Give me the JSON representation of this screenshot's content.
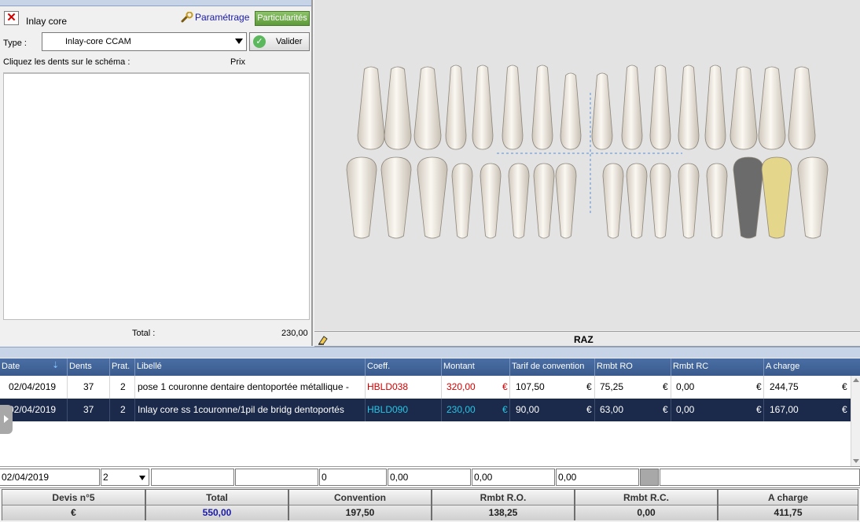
{
  "panel": {
    "title": "Inlay core",
    "close_icon": "✕",
    "param_label": "Paramétrage",
    "partic_label": "Particularités",
    "type_label": "Type :",
    "type_value": "Inlay-core CCAM",
    "valider_label": "Valider",
    "hint": "Cliquez les dents sur le schéma :",
    "prix_header": "Prix",
    "total_label": "Total :",
    "total_value": "230,00"
  },
  "chart_area": {
    "raz_label": "RAZ"
  },
  "grid": {
    "headers": {
      "date": "Date",
      "dents": "Dents",
      "prat": "Prat.",
      "libelle": "Libellé",
      "coeff": "Coeff.",
      "montant": "Montant",
      "tarif": "Tarif de convention",
      "rmbt_ro": "Rmbt RO",
      "rmbt_rc": "Rmbt RC",
      "a_charge": "A charge"
    },
    "rows": [
      {
        "date": "02/04/2019",
        "dents": "37",
        "prat": "2",
        "libelle": "pose 1 couronne dentaire dentoportée métallique -",
        "coeff": "HBLD038",
        "montant": "320,00",
        "montant_cur": "€",
        "tarif": "107,50",
        "tarif_cur": "€",
        "rmbt_ro": "75,25",
        "rmbt_ro_cur": "€",
        "rmbt_rc": "0,00",
        "rmbt_rc_cur": "€",
        "a_charge": "244,75",
        "a_charge_cur": "€"
      },
      {
        "date": "02/04/2019",
        "dents": "37",
        "prat": "2",
        "libelle": "Inlay core ss 1couronne/1pil de bridg dentoportés",
        "coeff": "HBLD090",
        "montant": "230,00",
        "montant_cur": "€",
        "tarif": "90,00",
        "tarif_cur": "€",
        "rmbt_ro": "63,00",
        "rmbt_ro_cur": "€",
        "rmbt_rc": "0,00",
        "rmbt_rc_cur": "€",
        "a_charge": "167,00",
        "a_charge_cur": "€"
      }
    ]
  },
  "edit_row": {
    "date": "02/04/2019",
    "prat": "2",
    "montant": "0",
    "tarif": "0,00",
    "rmbt_ro": "0,00",
    "rmbt_rc": "0,00"
  },
  "summary": {
    "devis_header": "Devis n°5",
    "devis_value": "€",
    "total_header": "Total",
    "total_value": "550,00",
    "convention_header": "Convention",
    "convention_value": "197,50",
    "ro_header": "Rmbt R.O.",
    "ro_value": "138,25",
    "rc_header": "Rmbt R.C.",
    "rc_value": "0,00",
    "charge_header": "A charge",
    "charge_value": "411,75"
  },
  "colors": {
    "selected_row_bg": "#1b2a4a",
    "coeff_red": "#d40000",
    "coeff_cyan": "#27c6e6",
    "crown_gray": "#6b6b6b",
    "inlay_gold": "#e4d68a"
  }
}
